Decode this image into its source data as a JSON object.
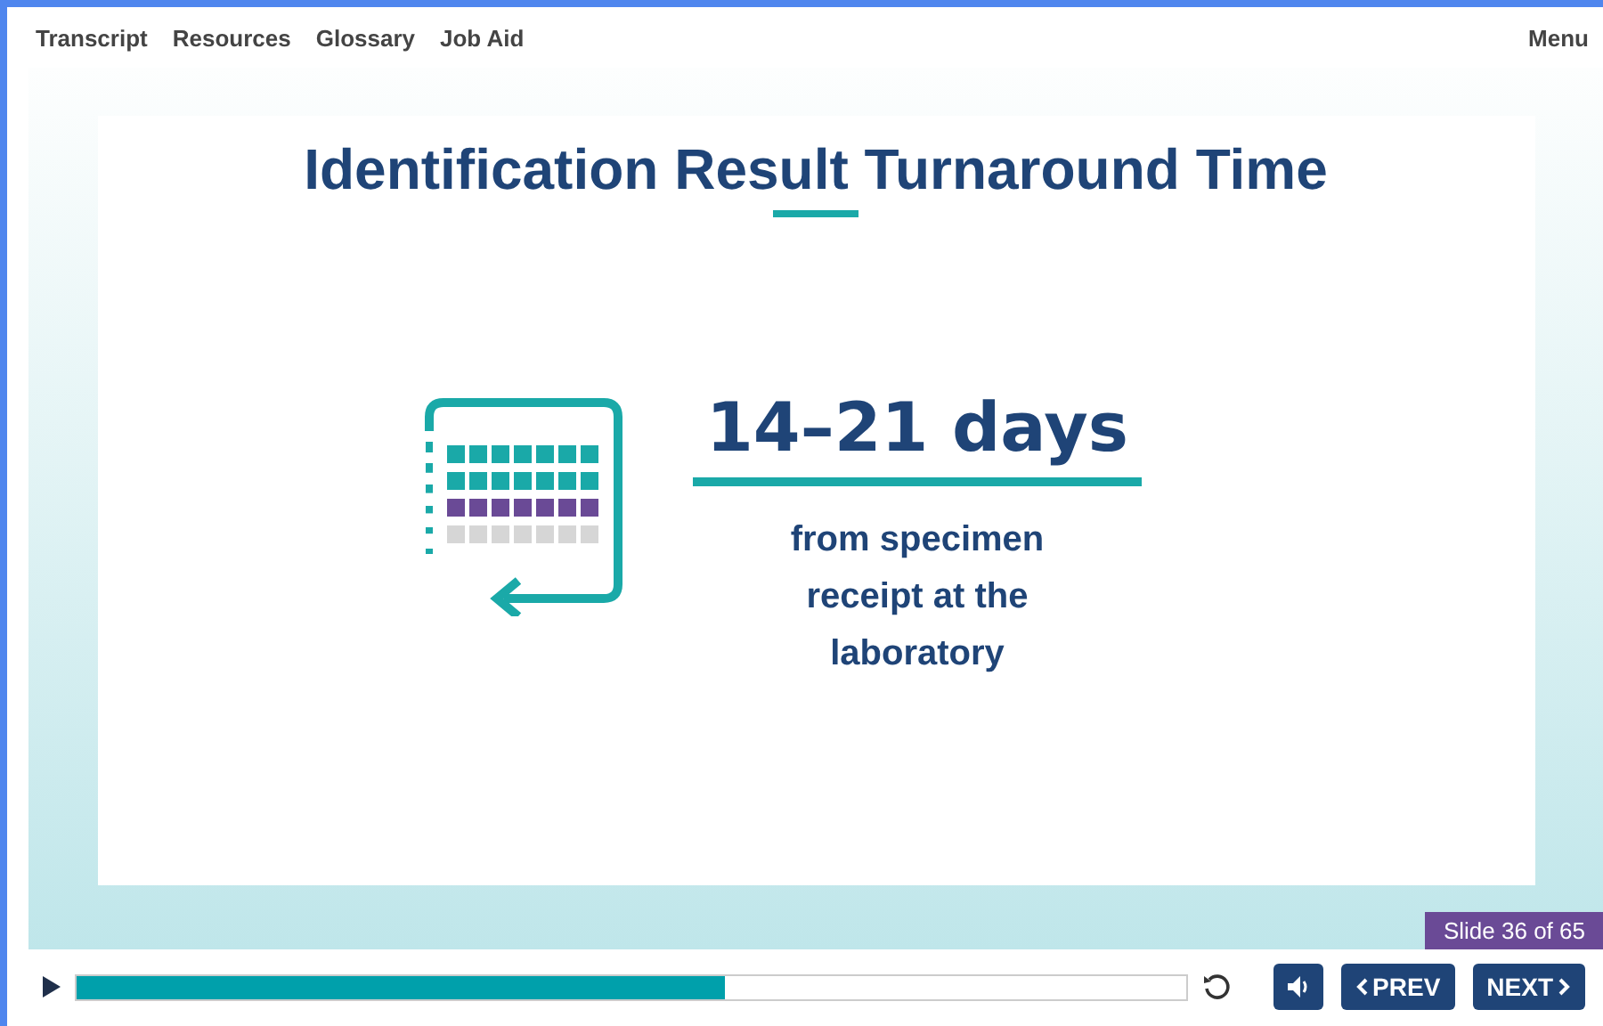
{
  "nav": {
    "links": [
      "Transcript",
      "Resources",
      "Glossary",
      "Job Aid"
    ],
    "menu": "Menu"
  },
  "slide": {
    "title": "Identification Result Turnaround Time",
    "headline": "14–21 days",
    "caption": "from specimen receipt at the laboratory"
  },
  "counter": "Slide 36 of 65",
  "player": {
    "playing": false,
    "level": 0.585,
    "muted": false,
    "prev": "PREV",
    "next": "NEXT"
  }
}
